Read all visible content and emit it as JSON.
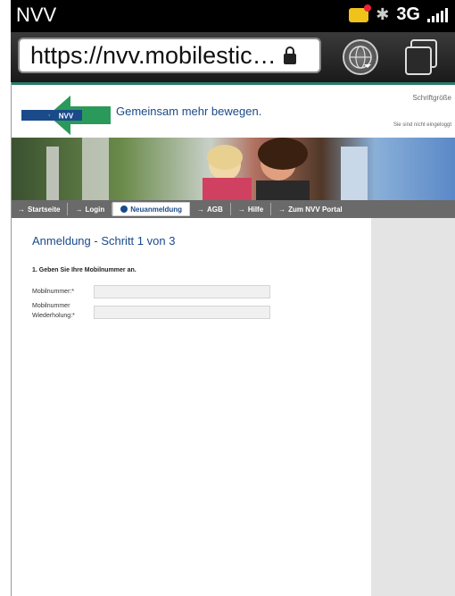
{
  "status": {
    "carrier": "NVV",
    "network": "3G",
    "icons": [
      "message-icon",
      "bluetooth-icon",
      "signal-icon"
    ]
  },
  "browser": {
    "url": "https://nvv.mobilestic…",
    "icons": [
      "lock-icon",
      "globe-icon",
      "tabs-icon"
    ]
  },
  "header": {
    "logo_text": "NVV",
    "slogan": "Gemeinsam mehr bewegen.",
    "fontsize_label": "Schriftgröße",
    "login_note": "Sie sind nicht eingeloggt"
  },
  "nav": {
    "items": [
      {
        "label": "Startseite"
      },
      {
        "label": "Login"
      },
      {
        "label": "Neuanmeldung"
      },
      {
        "label": "AGB"
      },
      {
        "label": "Hilfe"
      },
      {
        "label": "Zum NVV Portal"
      }
    ]
  },
  "form": {
    "title": "Anmeldung - Schritt 1 von 3",
    "step": "1. Geben Sie Ihre Mobilnummer an.",
    "mobile_label": "Mobilnummer:*",
    "repeat_label_1": "Mobilnummer",
    "repeat_label_2": "Wiederholung:*",
    "mobile_value": "",
    "repeat_value": ""
  },
  "colors": {
    "brand_blue": "#1a4a8a",
    "brand_green": "#2a9a5a",
    "nav_bg": "#6a6a6a"
  }
}
